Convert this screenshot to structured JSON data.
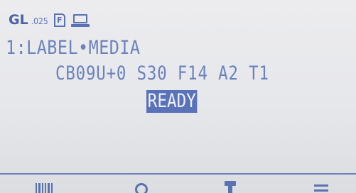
{
  "status_bar": {
    "brand": "GL",
    "version": ".025",
    "file_icon": "file-icon",
    "file_letter": "F",
    "device_icon": "laptop-icon"
  },
  "display": {
    "line1": "1:LABEL•MEDIA",
    "line2": "CB09U+0 S30 F14 A2 T1",
    "status": "READY"
  },
  "softkeys": [
    {
      "icon": "barcode-icon"
    },
    {
      "icon": "search-icon"
    },
    {
      "icon": "tool-icon"
    },
    {
      "icon": "menu-icon"
    }
  ],
  "colors": {
    "text": "#6b82bd",
    "accent": "#5a71b2",
    "highlight_bg": "#5a72b8",
    "highlight_text": "#eef1fb",
    "background": "#e8e9ec"
  }
}
